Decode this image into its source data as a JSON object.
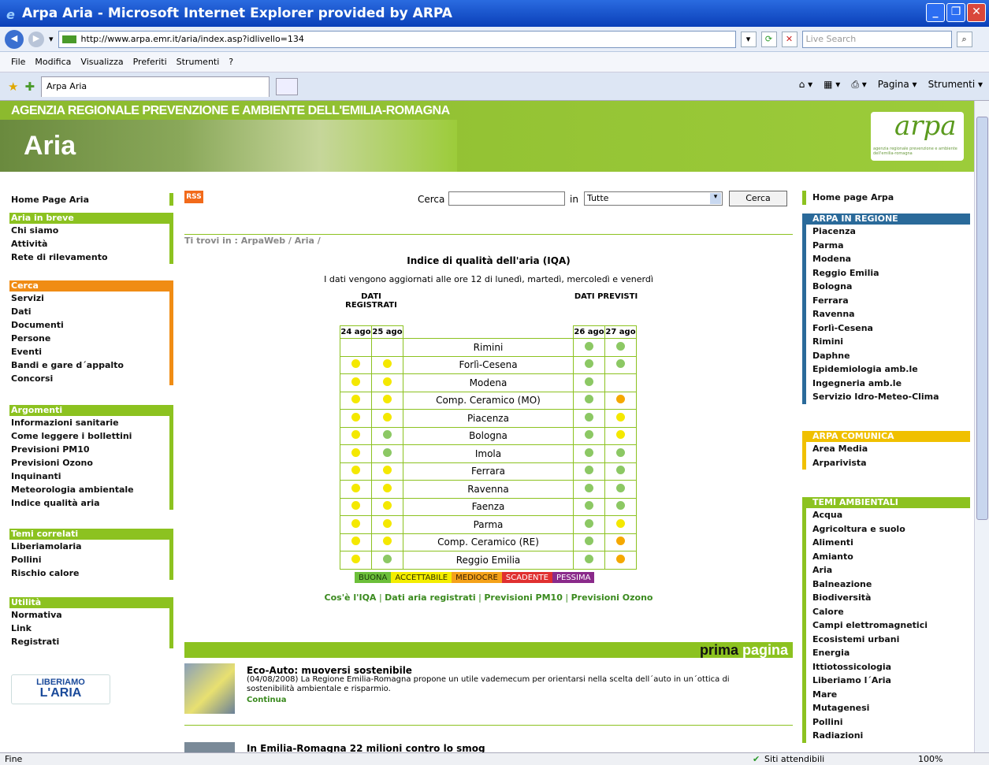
{
  "browser": {
    "title": "Arpa Aria - Microsoft Internet Explorer provided by ARPA",
    "url": "http://www.arpa.emr.it/aria/index.asp?idlivello=134",
    "search_placeholder": "Live Search",
    "menu": [
      "File",
      "Modifica",
      "Visualizza",
      "Preferiti",
      "Strumenti",
      "?"
    ],
    "tab_label": "Arpa Aria",
    "cmd": [
      "Pagina ▾",
      "Strumenti ▾"
    ],
    "status_left": "Fine",
    "status_zone": "Siti attendibili",
    "zoom": "100%"
  },
  "banner": {
    "title": "AGENZIA REGIONALE PREVENZIONE E AMBIENTE DELL'EMILIA-ROMAGNA",
    "section": "Aria",
    "logo": "arpa",
    "logo_sub": "agenzia regionale prevenzione e ambiente dell'emilia-romagna"
  },
  "left_nav": {
    "home": "Home Page Aria",
    "groups": [
      {
        "title": "Aria in breve",
        "color": "#8cc220",
        "items": [
          "Chi siamo",
          "Attività",
          "Rete di rilevamento"
        ]
      },
      {
        "title": "Cerca",
        "color": "#f08c14",
        "items": [
          "Servizi",
          "Dati",
          "Documenti",
          "Persone",
          "Eventi",
          "Bandi e gare d´appalto",
          "Concorsi"
        ]
      },
      {
        "title": "Argomenti",
        "color": "#8cc220",
        "items": [
          "Informazioni sanitarie",
          "Come leggere i bollettini",
          "Previsioni PM10",
          "Previsioni Ozono",
          "Inquinanti",
          "Meteorologia ambientale",
          "Indice qualità aria"
        ]
      },
      {
        "title": "Temi correlati",
        "color": "#8cc220",
        "items": [
          "Liberiamolaria",
          "Pollini",
          "Rischio calore"
        ]
      },
      {
        "title": "Utilità",
        "color": "#8cc220",
        "items": [
          "Normativa",
          "Link",
          "Registrati"
        ]
      }
    ],
    "badge_line1": "LIBERIAMO",
    "badge_line2": "L'ARIA"
  },
  "search": {
    "rss": "RSS",
    "label": "Cerca",
    "in_label": "in",
    "scope_value": "Tutte",
    "button": "Cerca"
  },
  "breadcrumb": "Ti trovi in : ArpaWeb / Aria /",
  "iqa": {
    "title": "Indice di qualità dell'aria (IQA)",
    "note": "I dati vengono aggiornati alle ore 12 di lunedì, martedì, mercoledì e venerdì",
    "registered_header": "DATI REGISTRATI",
    "forecast_header": "DATI PREVISTI",
    "dates": [
      "24 ago",
      "25 ago",
      "26 ago",
      "27 ago"
    ],
    "rows": [
      {
        "city": "Rimini",
        "v": [
          "",
          "",
          "buona",
          "buona"
        ]
      },
      {
        "city": "Forlì-Cesena",
        "v": [
          "accettabile",
          "accettabile",
          "buona",
          "buona"
        ]
      },
      {
        "city": "Modena",
        "v": [
          "accettabile",
          "accettabile",
          "buona",
          ""
        ]
      },
      {
        "city": "Comp. Ceramico (MO)",
        "v": [
          "accettabile",
          "accettabile",
          "buona",
          "mediocre"
        ]
      },
      {
        "city": "Piacenza",
        "v": [
          "accettabile",
          "accettabile",
          "buona",
          "accettabile"
        ]
      },
      {
        "city": "Bologna",
        "v": [
          "accettabile",
          "buona",
          "buona",
          "accettabile"
        ]
      },
      {
        "city": "Imola",
        "v": [
          "accettabile",
          "buona",
          "buona",
          "buona"
        ]
      },
      {
        "city": "Ferrara",
        "v": [
          "accettabile",
          "accettabile",
          "buona",
          "buona"
        ]
      },
      {
        "city": "Ravenna",
        "v": [
          "accettabile",
          "accettabile",
          "buona",
          "buona"
        ]
      },
      {
        "city": "Faenza",
        "v": [
          "accettabile",
          "accettabile",
          "buona",
          "buona"
        ]
      },
      {
        "city": "Parma",
        "v": [
          "accettabile",
          "accettabile",
          "buona",
          "accettabile"
        ]
      },
      {
        "city": "Comp. Ceramico (RE)",
        "v": [
          "accettabile",
          "accettabile",
          "buona",
          "mediocre"
        ]
      },
      {
        "city": "Reggio Emilia",
        "v": [
          "accettabile",
          "buona",
          "buona",
          "mediocre"
        ]
      }
    ],
    "legend": [
      {
        "label": "BUONA",
        "bg": "#6cbf3a",
        "fg": "#1a3a0a"
      },
      {
        "label": "ACCETTABILE",
        "bg": "#f4ee00",
        "fg": "#333300"
      },
      {
        "label": "MEDIOCRE",
        "bg": "#f5a21a",
        "fg": "#3a2000"
      },
      {
        "label": "SCADENTE",
        "bg": "#e03030",
        "fg": "#ffffff"
      },
      {
        "label": "PESSIMA",
        "bg": "#8a2a8a",
        "fg": "#ffffff"
      }
    ],
    "colors": {
      "buona": "#8cc864",
      "accettabile": "#f4e800",
      "mediocre": "#f5a800"
    },
    "links": [
      "Cos'è l'IQA",
      "Dati aria registrati",
      "Previsioni PM10",
      "Previsioni Ozono"
    ]
  },
  "prima_pagina": {
    "label_a": "prima",
    "label_b": "pagina",
    "news": [
      {
        "title": "Eco-Auto: muoversi sostenibile",
        "text": "(04/08/2008) La Regione Emilia-Romagna propone un utile vademecum per orientarsi nella scelta dell´auto in un´ottica di sostenibilità ambientale e risparmio.",
        "more": "Continua"
      },
      {
        "title": "In Emilia-Romagna 22 milioni contro lo smog"
      }
    ]
  },
  "right_nav": {
    "home": "Home page Arpa",
    "groups": [
      {
        "title": "ARPA IN REGIONE",
        "items": [
          "Piacenza",
          "Parma",
          "Modena",
          "Reggio Emilia",
          "Bologna",
          "Ferrara",
          "Ravenna",
          "Forlì-Cesena",
          "Rimini",
          "Daphne",
          "Epidemiologia amb.le",
          "Ingegneria amb.le",
          "Servizio Idro-Meteo-Clima"
        ]
      },
      {
        "title": "ARPA COMUNICA",
        "items": [
          "Area Media",
          "Arparivista"
        ]
      },
      {
        "title": "TEMI AMBIENTALI",
        "items": [
          "Acqua",
          "Agricoltura e suolo",
          "Alimenti",
          "Amianto",
          "Aria",
          "Balneazione",
          "Biodiversità",
          "Calore",
          "Campi elettromagnetici",
          "Ecosistemi urbani",
          "Energia",
          "Ittiotossicologia",
          "Liberiamo l´Aria",
          "Mare",
          "Mutagenesi",
          "Pollini",
          "Radiazioni"
        ]
      }
    ]
  }
}
